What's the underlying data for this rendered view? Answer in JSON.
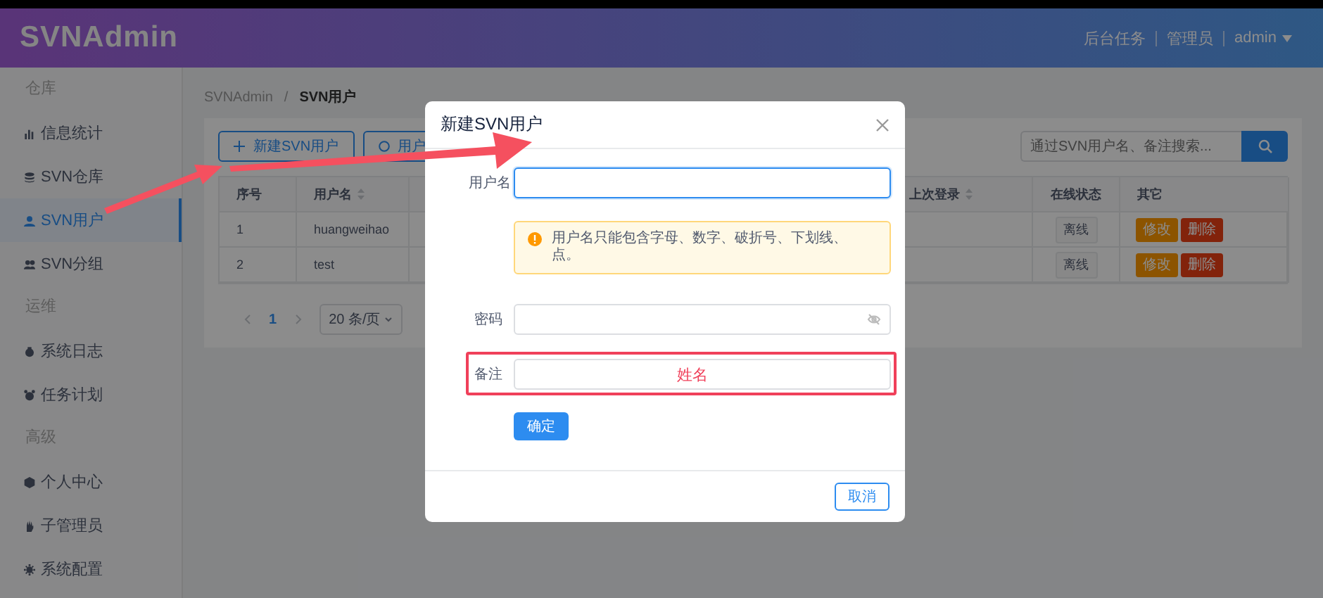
{
  "header": {
    "logo": "SVNAdmin",
    "nav": [
      "后台任务",
      "管理员",
      "admin"
    ]
  },
  "sidebar": {
    "items": [
      {
        "kind": "heading",
        "label": "仓库"
      },
      {
        "kind": "item",
        "label": "信息统计",
        "selected": false
      },
      {
        "kind": "item",
        "label": "SVN仓库",
        "selected": false
      },
      {
        "kind": "item",
        "label": "SVN用户",
        "selected": true
      },
      {
        "kind": "item",
        "label": "SVN分组",
        "selected": false
      },
      {
        "kind": "heading",
        "label": "运维"
      },
      {
        "kind": "item",
        "label": "系统日志",
        "selected": false
      },
      {
        "kind": "item",
        "label": "任务计划",
        "selected": false
      },
      {
        "kind": "heading",
        "label": "高级"
      },
      {
        "kind": "item",
        "label": "个人中心",
        "selected": false
      },
      {
        "kind": "item",
        "label": "子管理员",
        "selected": false
      },
      {
        "kind": "item",
        "label": "系统配置",
        "selected": false
      }
    ]
  },
  "breadcrumb": {
    "items": [
      "SVNAdmin",
      "SVN用户"
    ],
    "separator": "/"
  },
  "toolbar": {
    "buttons": [
      "新建SVN用户",
      "用户"
    ],
    "search": {
      "placeholder": "通过SVN用户名、备注搜索..."
    }
  },
  "table": {
    "columns": [
      {
        "label": "序号",
        "sortable": false
      },
      {
        "label": "用户名",
        "sortable": true
      },
      {
        "label": "上次登录",
        "sortable": true
      },
      {
        "label": "在线状态",
        "sortable": false
      },
      {
        "label": "其它",
        "sortable": false
      }
    ],
    "rows": [
      {
        "index": "1",
        "username": "huangweihao",
        "status": "离线",
        "actions": [
          "修改",
          "删除"
        ]
      },
      {
        "index": "2",
        "username": "test",
        "status": "离线",
        "actions": [
          "修改",
          "删除"
        ]
      }
    ]
  },
  "pagination": {
    "page": "1",
    "page_size": "20 条/页"
  },
  "modal": {
    "title": "新建SVN用户",
    "fields": [
      {
        "kind": "text",
        "label": "用户名",
        "focused": true,
        "highlighted": false
      },
      {
        "kind": "alert",
        "text": "用户名只能包含字母、数字、破折号、下划线、点。"
      },
      {
        "kind": "password",
        "label": "密码",
        "focused": false,
        "highlighted": false
      },
      {
        "kind": "text",
        "label": "备注",
        "focused": false,
        "highlighted": true,
        "annotation": "姓名"
      }
    ],
    "confirm": "确定",
    "cancel": "取消"
  }
}
